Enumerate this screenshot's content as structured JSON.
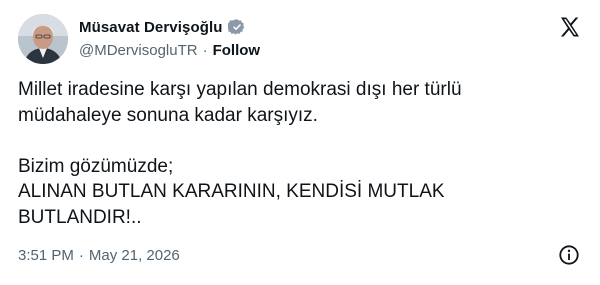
{
  "author": {
    "name": "Müsavat Dervişoğlu",
    "handle": "@MDervisogluTR",
    "separator": "·",
    "follow_label": "Follow",
    "verified_icon": "verified-badge-icon",
    "verified_color": "#8a9aa9"
  },
  "platform": {
    "logo_icon": "x-logo-icon"
  },
  "tweet": {
    "line1": "Millet iradesine karşı yapılan demokrasi dışı her türlü",
    "line2": "müdahaleye sonuna kadar karşıyız.",
    "line3": "Bizim gözümüzde;",
    "line4": "ALINAN BUTLAN KARARININ, KENDİSİ MUTLAK",
    "line5": "BUTLANDIR!.."
  },
  "meta": {
    "time": "3:51 PM",
    "separator": "·",
    "date": "May 21, 2026",
    "info_icon": "info-icon"
  },
  "colors": {
    "text": "#0f1419",
    "secondary": "#536471",
    "background": "#ffffff"
  }
}
